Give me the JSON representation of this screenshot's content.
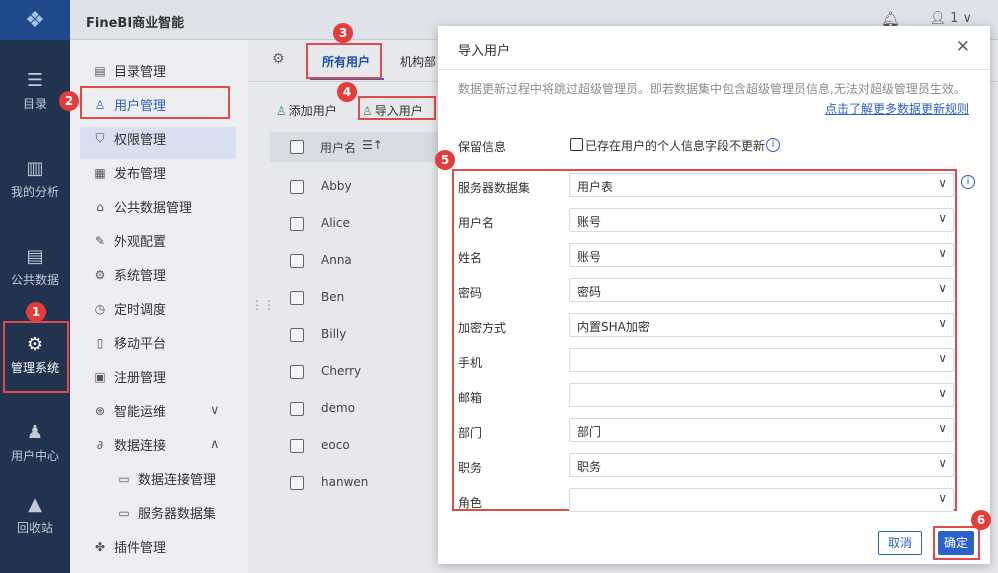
{
  "app": {
    "brand": "FineBI商业智能",
    "user_label": "1 ∨"
  },
  "leftnav": [
    {
      "label": "目录",
      "icon": "catalog-icon"
    },
    {
      "label": "我的分析",
      "icon": "analysis-icon"
    },
    {
      "label": "公共数据",
      "icon": "public-data-icon"
    },
    {
      "label": "管理系统",
      "icon": "management-icon"
    },
    {
      "label": "用户中心",
      "icon": "user-center-icon"
    },
    {
      "label": "回收站",
      "icon": "recycle-bin-icon"
    }
  ],
  "menu": [
    {
      "label": "目录管理"
    },
    {
      "label": "用户管理"
    },
    {
      "label": "权限管理"
    },
    {
      "label": "发布管理"
    },
    {
      "label": "公共数据管理"
    },
    {
      "label": "外观配置"
    },
    {
      "label": "系统管理"
    },
    {
      "label": "定时调度"
    },
    {
      "label": "移动平台"
    },
    {
      "label": "注册管理"
    },
    {
      "label": "智能运维"
    },
    {
      "label": "数据连接"
    },
    {
      "label": "数据连接管理"
    },
    {
      "label": "服务器数据集"
    },
    {
      "label": "插件管理"
    }
  ],
  "tabs": {
    "all_users": "所有用户",
    "org": "机构部"
  },
  "toolbar": {
    "add_user": "添加用户",
    "import_user": "导入用户"
  },
  "table": {
    "header": "用户名",
    "rows": [
      "Abby",
      "Alice",
      "Anna",
      "Ben",
      "Billy",
      "Cherry",
      "demo",
      "eoco",
      "hanwen"
    ]
  },
  "dialog": {
    "title": "导入用户",
    "note": "数据更新过程中将跳过超级管理员。即若数据集中包含超级管理员信息,无法对超级管理员生效。",
    "link": "点击了解更多数据更新规则",
    "keep_label": "保留信息",
    "keep_text": "已存在用户的个人信息字段不更新",
    "fields": [
      {
        "label": "服务器数据集",
        "value": "用户表"
      },
      {
        "label": "用户名",
        "value": "账号"
      },
      {
        "label": "姓名",
        "value": "账号"
      },
      {
        "label": "密码",
        "value": "密码"
      },
      {
        "label": "加密方式",
        "value": "内置SHA加密"
      },
      {
        "label": "手机",
        "value": ""
      },
      {
        "label": "邮箱",
        "value": ""
      },
      {
        "label": "部门",
        "value": "部门"
      },
      {
        "label": "职务",
        "value": "职务"
      },
      {
        "label": "角色",
        "value": ""
      }
    ],
    "cancel": "取消",
    "ok": "确定"
  },
  "badges": [
    "1",
    "2",
    "3",
    "4",
    "5",
    "6"
  ],
  "colors": {
    "accent": "#2b61c8",
    "highlight": "#e24a4a",
    "nav_bg": "#22334f"
  }
}
